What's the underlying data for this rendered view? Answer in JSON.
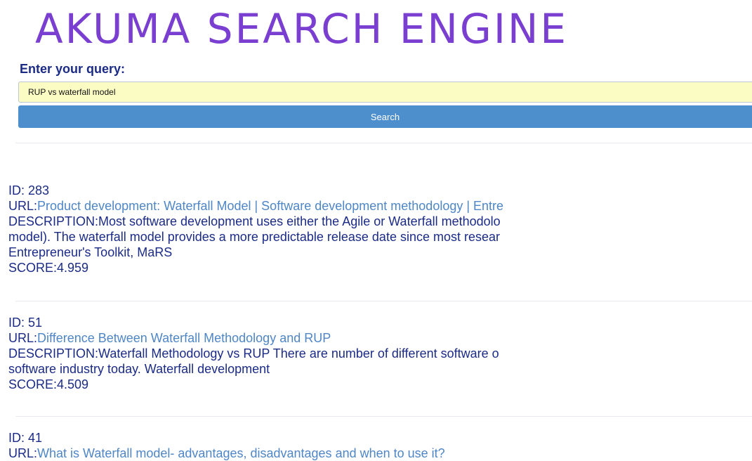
{
  "header": {
    "title": "AKUMA SEARCH ENGINE"
  },
  "search": {
    "label": "Enter your query:",
    "query_value": "RUP vs waterfall model",
    "button_label": "Search"
  },
  "results": [
    {
      "id_label": "ID: 283",
      "url_prefix": "URL:",
      "url_text": "Product development: Waterfall Model | Software development methodology | Entre",
      "desc_prefix": "DESCRIPTION:",
      "desc_line1": "Most software development uses either the Agile or Waterfall methodolo",
      "desc_line2": "model). The waterfall model provides a more predictable release date since most resear",
      "desc_line3": "Entrepreneur's Toolkit, MaRS",
      "score_label": "SCORE:4.959"
    },
    {
      "id_label": "ID: 51",
      "url_prefix": "URL:",
      "url_text": "Difference Between Waterfall Methodology and RUP",
      "desc_prefix": "DESCRIPTION:",
      "desc_line1": "Waterfall Methodology vs RUP There are number of different software o",
      "desc_line2": "software industry today. Waterfall development",
      "score_label": "SCORE:4.509"
    },
    {
      "id_label": "ID: 41",
      "url_prefix": "URL:",
      "url_text": "What is Waterfall model- advantages, disadvantages and when to use it?"
    }
  ]
}
